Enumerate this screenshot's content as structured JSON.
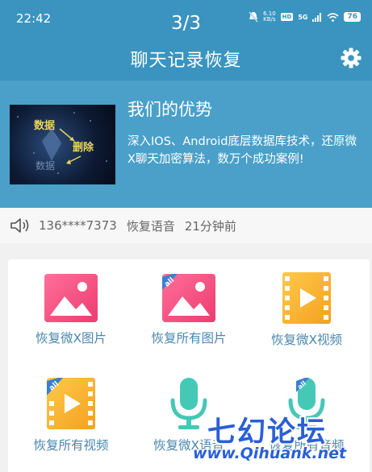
{
  "status_bar": {
    "time": "22:42",
    "net_speed": "6.10\nKB/s",
    "hd": "HD",
    "signal": "5G",
    "battery": "76"
  },
  "page_counter": "3/3",
  "header": {
    "title": "聊天记录恢复",
    "settings_icon": "gear-icon"
  },
  "banner": {
    "title": "我们的优势",
    "text": "深入IOS、Android底层数据库技术，还原微X聊天加密算法，数万个成功案例!",
    "image_words": [
      "数据",
      "删除",
      "数据"
    ]
  },
  "notice": {
    "icon": "speaker-icon",
    "phone": "136****7373",
    "action": "恢复语音",
    "time": "21分钟前"
  },
  "features": [
    {
      "label": "恢复微X图片",
      "icon": "image-icon"
    },
    {
      "label": "恢复所有图片",
      "icon": "image-all-icon"
    },
    {
      "label": "恢复微X视频",
      "icon": "video-icon"
    },
    {
      "label": "恢复所有视频",
      "icon": "video-all-icon"
    },
    {
      "label": "恢复微X语音",
      "icon": "microphone-icon"
    },
    {
      "label": "恢复所有音频",
      "icon": "microphone-all-icon"
    }
  ],
  "watermark": {
    "brand": "七幻论坛",
    "url": "www.Qihuank.net"
  },
  "colors": {
    "header_bg": "#3a94bf",
    "banner_bg": "#4aa0c9",
    "label": "#4a87ad",
    "pink": "#f0497e",
    "orange": "#f7b733",
    "teal": "#3ec4b4"
  }
}
